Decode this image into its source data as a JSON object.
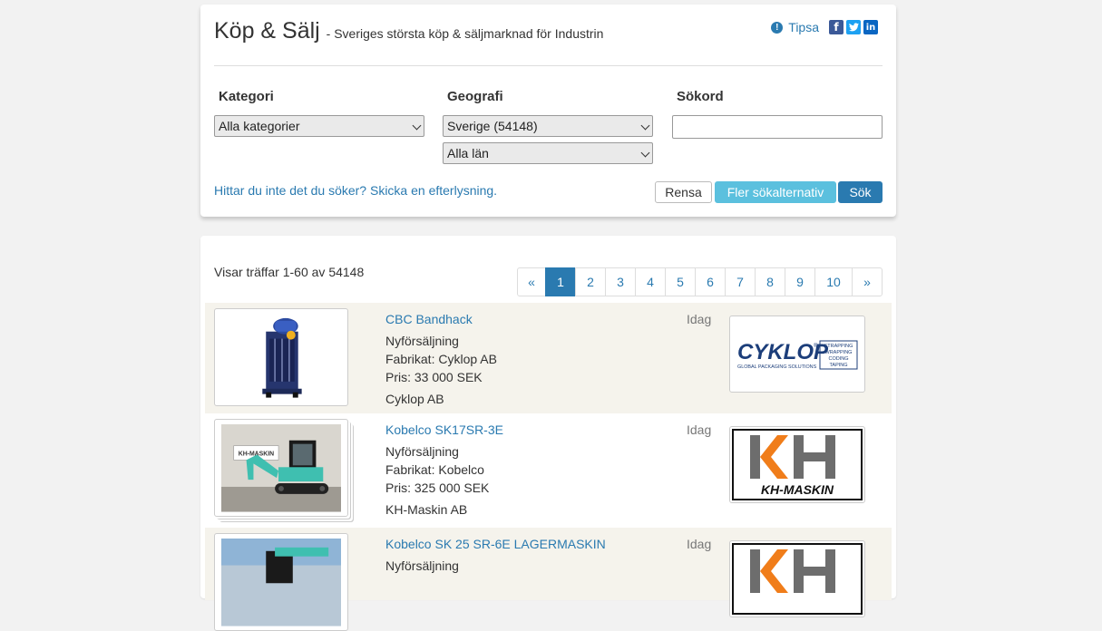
{
  "header": {
    "title": "Köp & Sälj",
    "subtitle": "- Sveriges största köp & säljmarknad för Industrin",
    "tipsa": "Tipsa",
    "tipsa_icon": "exclamation-circle-icon",
    "social": [
      "facebook-icon",
      "twitter-icon",
      "linkedin-icon"
    ]
  },
  "filters": {
    "category_label": "Kategori",
    "category_value": "Alla kategorier",
    "geo_label": "Geografi",
    "geo_value": "Sverige (54148)",
    "county_value": "Alla län",
    "keyword_label": "Sökord",
    "keyword_value": ""
  },
  "actions": {
    "efterlysning": "Hittar du inte det du söker? Skicka en efterlysning.",
    "clear": "Rensa",
    "more": "Fler sökalternativ",
    "search": "Sök"
  },
  "results": {
    "count_text": "Visar träffar 1-60 av 54148",
    "pages": [
      "«",
      "1",
      "2",
      "3",
      "4",
      "5",
      "6",
      "7",
      "8",
      "9",
      "10",
      "»"
    ],
    "active_page": "1"
  },
  "listings": [
    {
      "title": "CBC Bandhack",
      "type": "Nyförsäljning",
      "make": "Fabrikat: Cyklop AB",
      "price": "Pris: 33 000 SEK",
      "seller": "Cyklop AB",
      "date": "Idag",
      "logo": {
        "word": "CYKLOP",
        "mark": "®",
        "tagline": "GLOBAL PACKAGING SOLUTIONS",
        "box": [
          "STRAPPING",
          "WRAPPING",
          "CODING",
          "TAPING"
        ]
      }
    },
    {
      "title": "Kobelco SK17SR-3E",
      "type": "Nyförsäljning",
      "make": "Fabrikat: Kobelco",
      "price": "Pris: 325 000 SEK",
      "seller": "KH-Maskin AB",
      "date": "Idag",
      "logo": {
        "word": "KH-MASKIN"
      },
      "photo_text": "KH-MASKIN"
    },
    {
      "title": "Kobelco SK 25 SR-6E LAGERMASKIN",
      "type": "Nyförsäljning",
      "date": "Idag"
    }
  ],
  "colors": {
    "link": "#2a7ab0",
    "info_button": "#5bc0de",
    "primary": "#2a7ab0",
    "alt_row": "#f5f3ec",
    "kh_orange": "#f07d1a",
    "kh_gray": "#6d6d6d",
    "cyklop_blue": "#1c3e7a"
  }
}
